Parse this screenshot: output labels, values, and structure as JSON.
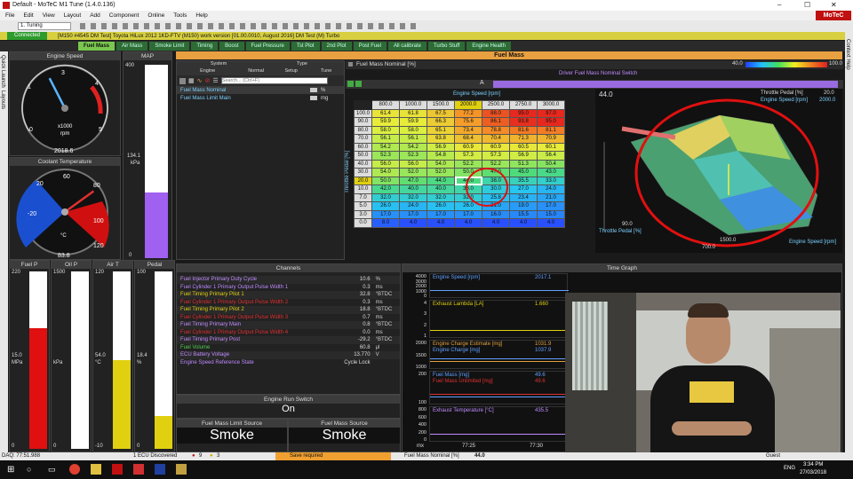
{
  "app": {
    "title": "Default - MoTeC M1 Tune (1.4.0.136)",
    "brand": "MoTeC"
  },
  "menu": [
    "File",
    "Edit",
    "View",
    "Layout",
    "Add",
    "Component",
    "Online",
    "Tools",
    "Help"
  ],
  "toolbar": {
    "workbook": "1. Tuning"
  },
  "status": {
    "connected": "Connected",
    "info": "[M150 #4545 DM Test] Toyota HiLux 2012 1KD-FTV (M150) work version [01.00.0010, August 2016] DM Test (M) Turbo"
  },
  "tabs": [
    "Fuel Mass",
    "Air Mass",
    "Smoke Limit",
    "Timing",
    "Boost",
    "Fuel Pressure",
    "Tst Plot",
    "2nd Plot",
    "Post Fuel",
    "All calibrate",
    "Turbo Stuff",
    "Engine Health"
  ],
  "side_tabs": [
    "Quick Launch",
    "Layouts"
  ],
  "right_tab": "Context Help",
  "gauges": {
    "engine_speed": {
      "title": "Engine Speed",
      "value": "2018.6",
      "unit": "rpm",
      "mult": "x1000",
      "ticks": [
        "0",
        "1",
        "2",
        "3",
        "4",
        "5"
      ],
      "fraction": 0.4
    },
    "map": {
      "title": "MAP",
      "value": "134.1",
      "unit": "kPa",
      "ticks": [
        "400",
        "0"
      ],
      "fraction": 0.34
    },
    "coolant": {
      "title": "Coolant Temperature",
      "value": "83.8",
      "unit": "°C",
      "ticks": [
        "-20",
        "20",
        "40",
        "60",
        "80",
        "100",
        "120"
      ],
      "fraction": 0.7
    }
  },
  "bars": [
    {
      "title": "Fuel P",
      "top": "220",
      "value": "15.0",
      "unit": "MPa",
      "bottom": "0",
      "color": "#e01010",
      "fraction": 0.68
    },
    {
      "title": "Oil P",
      "top": "1500",
      "value": "",
      "unit": "kPa",
      "bottom": "0",
      "color": "#e0d010",
      "fraction": 0
    },
    {
      "title": "Air T",
      "top": "120",
      "value": "54.0",
      "unit": "°C",
      "bottom": "-10",
      "color": "#e0d010",
      "fraction": 0.5
    },
    {
      "title": "Pedal",
      "top": "100",
      "value": "18.4",
      "unit": "%",
      "bottom": "0",
      "color": "#e0d010",
      "fraction": 0.184
    }
  ],
  "fuel_mass": {
    "panel_title": "Fuel Mass",
    "table_title": "Fuel Mass Nominal [%]",
    "scale_min": "40.0",
    "scale_max": "100.0",
    "switch_label": "Driver Fuel Mass Nominal Switch",
    "axis_label": "A",
    "x_title": "Engine Speed [rpm]",
    "y_title": "Throttle Pedal [%]",
    "x": [
      "800.0",
      "1000.0",
      "1500.0",
      "2000.0",
      "2500.0",
      "2750.0",
      "3000.0"
    ],
    "y": [
      "100.0",
      "90.0",
      "80.0",
      "70.0",
      "60.0",
      "50.0",
      "40.0",
      "30.0",
      "20.0",
      "10.0",
      "7.0",
      "5.0",
      "3.0",
      "0.0"
    ],
    "cells": [
      [
        "61.4",
        "61.8",
        "67.5",
        "77.2",
        "88.0",
        "95.0",
        "97.0"
      ],
      [
        "59.9",
        "59.9",
        "66.3",
        "75.6",
        "86.1",
        "93.8",
        "95.0"
      ],
      [
        "58.0",
        "58.0",
        "65.1",
        "73.4",
        "78.8",
        "81.6",
        "81.1"
      ],
      [
        "56.1",
        "56.1",
        "63.8",
        "68.4",
        "70.4",
        "71.3",
        "70.9"
      ],
      [
        "54.2",
        "54.2",
        "56.9",
        "60.9",
        "60.9",
        "60.5",
        "60.1"
      ],
      [
        "52.3",
        "52.3",
        "54.8",
        "57.3",
        "57.3",
        "56.9",
        "56.4"
      ],
      [
        "56.0",
        "56.0",
        "54.0",
        "52.2",
        "52.2",
        "51.3",
        "50.4"
      ],
      [
        "54.0",
        "52.0",
        "52.0",
        "50.0",
        "47.0",
        "45.0",
        "43.0"
      ],
      [
        "50.0",
        "47.0",
        "44.0",
        "44.0",
        "38.0",
        "35.5",
        "33.0"
      ],
      [
        "42.0",
        "40.0",
        "40.0",
        "38.0",
        "30.0",
        "27.0",
        "24.0"
      ],
      [
        "32.0",
        "32.0",
        "32.0",
        "32.0",
        "25.8",
        "23.4",
        "21.0"
      ],
      [
        "26.0",
        "24.0",
        "26.0",
        "26.0",
        "21.0",
        "19.0",
        "17.0"
      ],
      [
        "17.0",
        "17.0",
        "17.0",
        "17.0",
        "16.0",
        "15.5",
        "15.0"
      ],
      [
        "8.0",
        "4.0",
        "4.0",
        "4.0",
        "4.0",
        "4.0",
        "4.0"
      ]
    ],
    "selected_row": "20.0",
    "selected_col": "2000.0",
    "selected_value": "44.0",
    "chart3d": {
      "z_max": "44.0",
      "throttle_label": "Throttle Pedal [%]",
      "throttle_value": "20.0",
      "speed_label": "Engine Speed [rpm]",
      "speed_value": "2000.0",
      "z_ticks": [
        "44.0"
      ],
      "x_ticks": [
        "700.0",
        "1500.0"
      ],
      "y_ticks": [
        "90.0",
        "30.0",
        "20.0",
        "10.0",
        "0.0"
      ]
    }
  },
  "properties": {
    "cols": [
      "System",
      "Type"
    ],
    "subcols": [
      "Engine",
      "Normal",
      "Setup",
      "Tune"
    ],
    "search_placeholder": "Search... (Ctrl+F)",
    "rows": [
      {
        "name": "Fuel Mass Nominal",
        "unit": "%"
      },
      {
        "name": "Fuel Mass Limit Main",
        "unit": "mg"
      }
    ]
  },
  "channels": {
    "title": "Channels",
    "rows": [
      {
        "name": "Fuel Injector Primary Duty Cycle",
        "value": "10.6",
        "unit": "%",
        "color": "#c08cff"
      },
      {
        "name": "Fuel Cylinder 1 Primary Output Pulse Width 1",
        "value": "0.3",
        "unit": "ms",
        "color": "#c08cff"
      },
      {
        "name": "Fuel Timing Primary Pilot 1",
        "value": "32.8",
        "unit": "°BTDC",
        "color": "#e0d010"
      },
      {
        "name": "Fuel Cylinder 1 Primary Output Pulse Width 2",
        "value": "0.3",
        "unit": "ms",
        "color": "#e03030"
      },
      {
        "name": "Fuel Timing Primary Pilot 2",
        "value": "18.8",
        "unit": "°BTDC",
        "color": "#e0d010"
      },
      {
        "name": "Fuel Cylinder 1 Primary Output Pulse Width 3",
        "value": "0.7",
        "unit": "ms",
        "color": "#e03030"
      },
      {
        "name": "Fuel Timing Primary Main",
        "value": "0.8",
        "unit": "°BTDC",
        "color": "#c08cff"
      },
      {
        "name": "Fuel Cylinder 1 Primary Output Pulse Width 4",
        "value": "0.0",
        "unit": "ms",
        "color": "#e03030"
      },
      {
        "name": "Fuel Timing Primary Post",
        "value": "-29.2",
        "unit": "°BTDC",
        "color": "#c08cff"
      },
      {
        "name": "Fuel Volume",
        "value": "60.8",
        "unit": "µl",
        "color": "#50d050"
      },
      {
        "name": "ECU Battery Voltage",
        "value": "13.770",
        "unit": "V",
        "color": "#c08cff"
      },
      {
        "name": "Engine Speed Reference State",
        "value": "Cycle Lock",
        "unit": "",
        "color": "#c08cff"
      }
    ]
  },
  "run_switch": {
    "title": "Engine Run Switch",
    "value": "On"
  },
  "limit_source": {
    "title": "Fuel Mass Limit Source",
    "value": "Smoke"
  },
  "mass_source": {
    "title": "Fuel Mass Source",
    "value": "Smoke"
  },
  "time_graph": {
    "title": "Time Graph",
    "traces": [
      {
        "label": "Engine Speed [rpm]",
        "value": "2017.1",
        "color": "#60a0ff",
        "ticks": [
          "4000",
          "3000",
          "2000",
          "1000",
          "0"
        ]
      },
      {
        "label": "Exhaust Lambda [LA]",
        "value": "1.660",
        "color": "#e0d010",
        "ticks": [
          "4",
          "3",
          "2",
          "1"
        ]
      },
      {
        "label": "Engine Charge Estimate [mg]",
        "value": "1031.9",
        "color": "#e0a040",
        "ticks": [
          "2000",
          "1500",
          "1000"
        ]
      },
      {
        "label": "Engine Charge [mg]",
        "value": "1037.9",
        "color": "#60a0ff",
        "ticks": []
      },
      {
        "label": "Fuel Mass [mg]",
        "value": "49.6",
        "color": "#60a0ff",
        "ticks": [
          "200",
          "100"
        ]
      },
      {
        "label": "Fuel Mass Unlimited [mg]",
        "value": "49.6",
        "color": "#e03030",
        "ticks": []
      },
      {
        "label": "Exhaust Temperature [°C]",
        "value": "435.5",
        "color": "#c08cff",
        "ticks": [
          "800",
          "600",
          "400",
          "200",
          "0"
        ]
      }
    ],
    "x_ticks": [
      "77:25",
      "77:30"
    ],
    "x_unit": "mx"
  },
  "statusbar": {
    "daq": "DAQ: 77:51.988",
    "ecu": "1 ECU Discovered",
    "errors": "9",
    "warnings": "3",
    "save": "Save required",
    "table": "Fuel Mass Nominal [%]",
    "value": "44.0",
    "user": "Guest"
  },
  "taskbar": {
    "lang": "ENG",
    "time": "3:34 PM",
    "date": "27/03/2018"
  }
}
